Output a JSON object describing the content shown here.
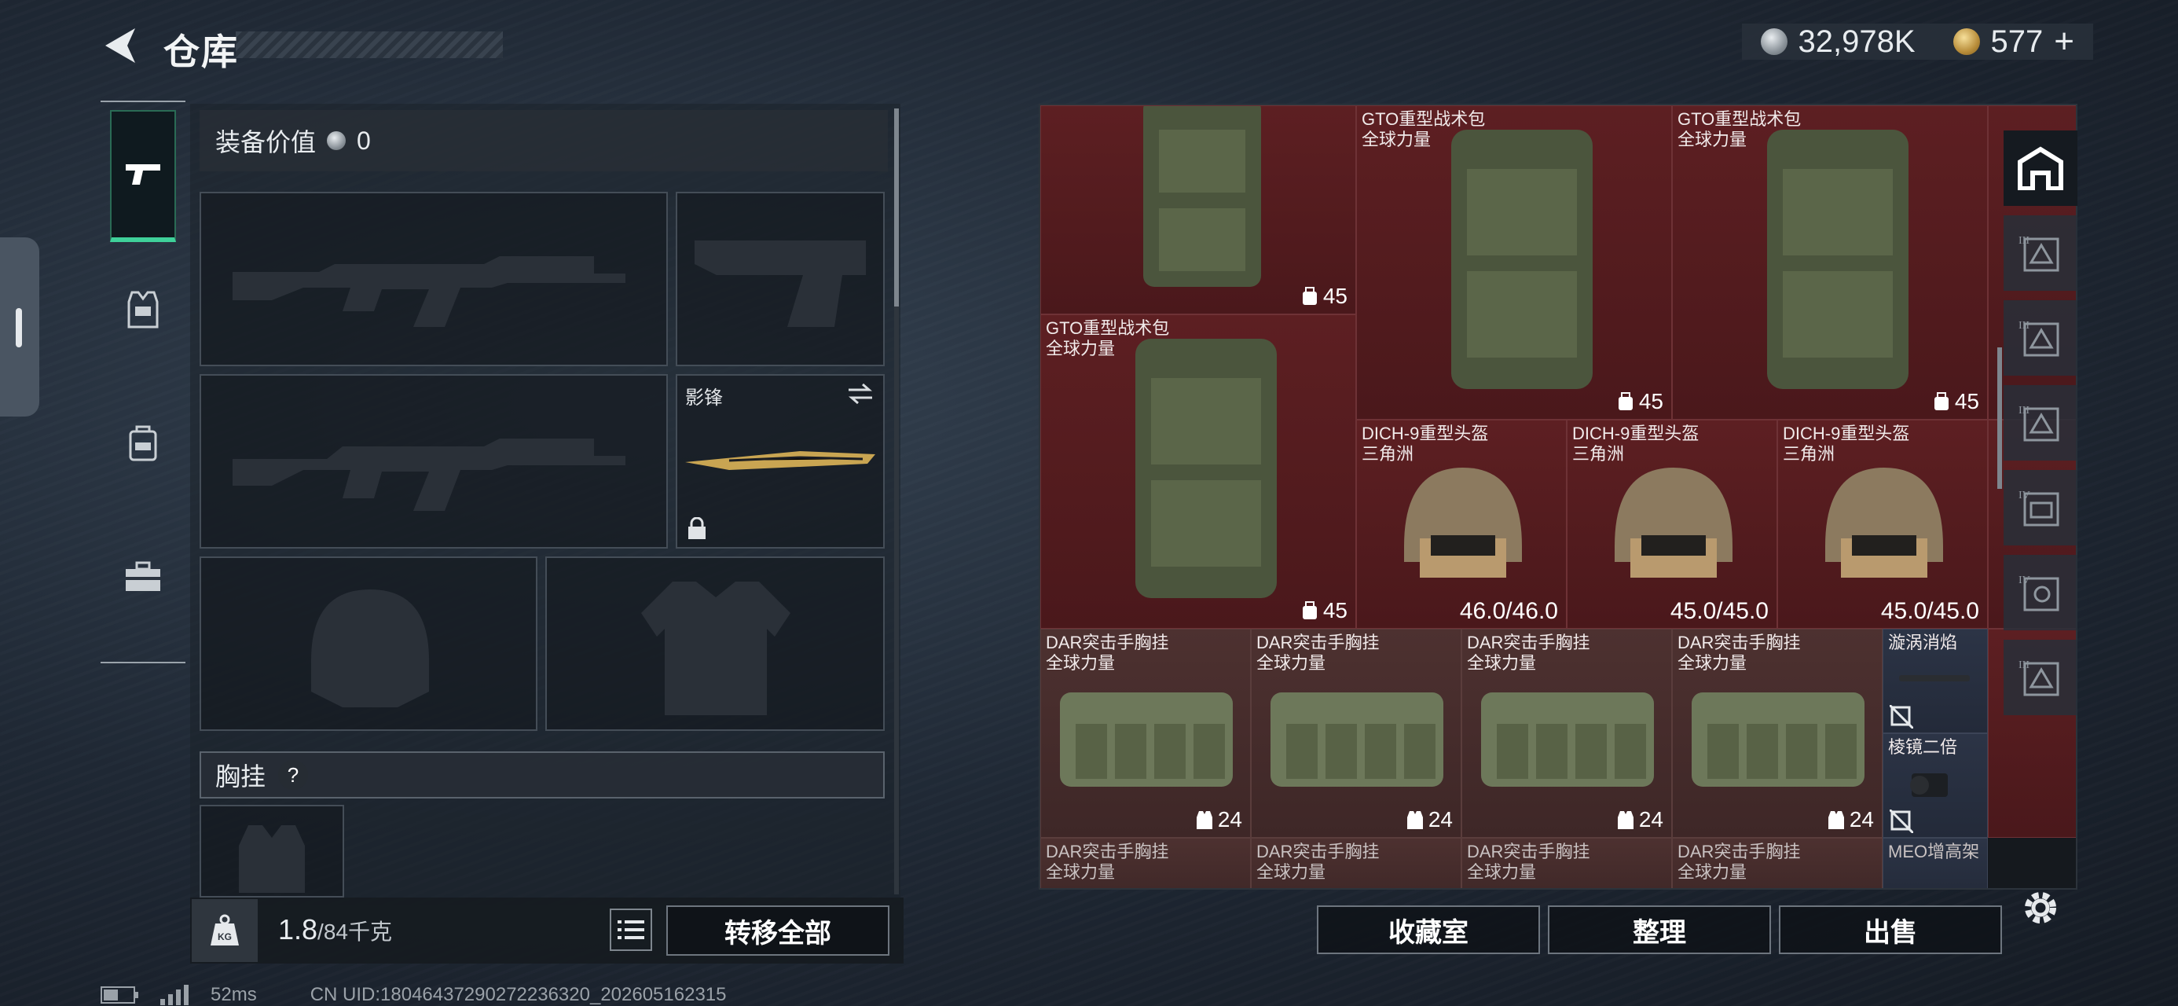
{
  "header": {
    "title": "仓库"
  },
  "currency": {
    "silver": "32,978K",
    "gold": "577",
    "gold_add": "+"
  },
  "equipment": {
    "value_label": "装备价值",
    "value": "0",
    "melee_slot_label": "影锋",
    "chest_label": "胸挂",
    "chest_help": "?"
  },
  "weight": {
    "current": "1.8",
    "max": "/84千克",
    "kg_icon": "KG"
  },
  "buttons": {
    "transfer_all": "转移全部",
    "collection": "收藏室",
    "organize": "整理",
    "sell": "出售"
  },
  "stash": {
    "items": [
      {
        "name": "",
        "sub": "",
        "count": "45",
        "count_icon": "backpack-icon"
      },
      {
        "name": "GTO重型战术包",
        "sub": "全球力量",
        "count": "45",
        "count_icon": "backpack-icon"
      },
      {
        "name": "GTO重型战术包",
        "sub": "全球力量",
        "count": "45",
        "count_icon": "backpack-icon"
      },
      {
        "name": "GTO重型战术包",
        "sub": "全球力量",
        "count": "45",
        "count_icon": "backpack-icon"
      },
      {
        "name": "DICH-9重型头盔",
        "sub": "三角洲",
        "durability": "46.0/46.0"
      },
      {
        "name": "DICH-9重型头盔",
        "sub": "三角洲",
        "durability": "45.0/45.0"
      },
      {
        "name": "DICH-9重型头盔",
        "sub": "三角洲",
        "durability": "45.0/45.0"
      },
      {
        "name": "DAR突击手胸挂",
        "sub": "全球力量",
        "count": "24",
        "count_icon": "vest-icon"
      },
      {
        "name": "DAR突击手胸挂",
        "sub": "全球力量",
        "count": "24",
        "count_icon": "vest-icon"
      },
      {
        "name": "DAR突击手胸挂",
        "sub": "全球力量",
        "count": "24",
        "count_icon": "vest-icon"
      },
      {
        "name": "DAR突击手胸挂",
        "sub": "全球力量",
        "count": "24",
        "count_icon": "vest-icon"
      },
      {
        "name": "漩涡消焰",
        "sub": ""
      },
      {
        "name": "棱镜二倍",
        "sub": ""
      },
      {
        "name": "DAR突击手胸挂",
        "sub": "全球力量"
      },
      {
        "name": "DAR突击手胸挂",
        "sub": "全球力量"
      },
      {
        "name": "DAR突击手胸挂",
        "sub": "全球力量"
      },
      {
        "name": "DAR突击手胸挂",
        "sub": "全球力量"
      },
      {
        "name": "MEO增高架",
        "sub": ""
      }
    ]
  },
  "right_nav": {
    "tiers": [
      "III",
      "III",
      "III",
      "IV",
      "IV",
      "III"
    ]
  },
  "status": {
    "latency": "52ms",
    "uid": "CN UID:18046437290272236320_202605162315"
  }
}
